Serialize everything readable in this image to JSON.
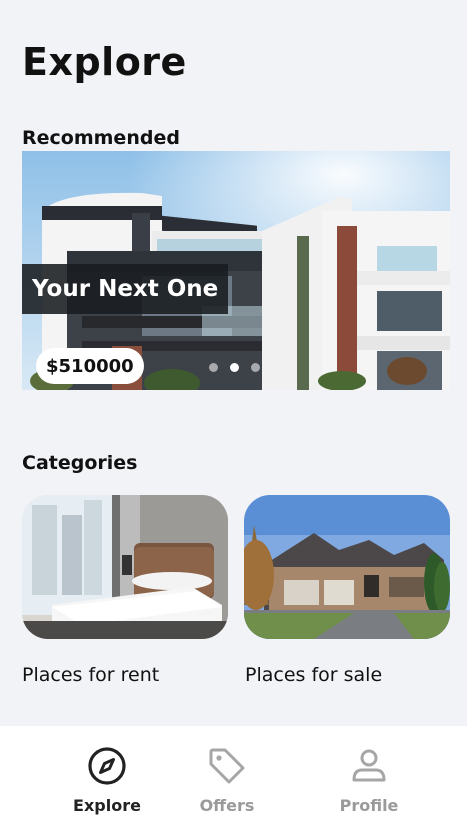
{
  "header": {
    "title": "Explore"
  },
  "recommended": {
    "section_title": "Recommended",
    "listing": {
      "caption": "Your Next One",
      "price": "$510000"
    },
    "pagination": {
      "count": 3,
      "active_index": 1
    }
  },
  "categories": {
    "section_title": "Categories",
    "items": [
      {
        "label": "Places for rent",
        "image": "bedroom-photo"
      },
      {
        "label": "Places for sale",
        "image": "suburban-house-photo"
      }
    ]
  },
  "bottom_nav": {
    "items": [
      {
        "label": "Explore",
        "icon": "compass-icon",
        "active": true
      },
      {
        "label": "Offers",
        "icon": "tag-icon",
        "active": false
      },
      {
        "label": "Profile",
        "icon": "person-icon",
        "active": false
      }
    ]
  },
  "colors": {
    "background": "#f2f3f7",
    "nav_active": "#222222",
    "nav_inactive": "#9a9a9a"
  }
}
